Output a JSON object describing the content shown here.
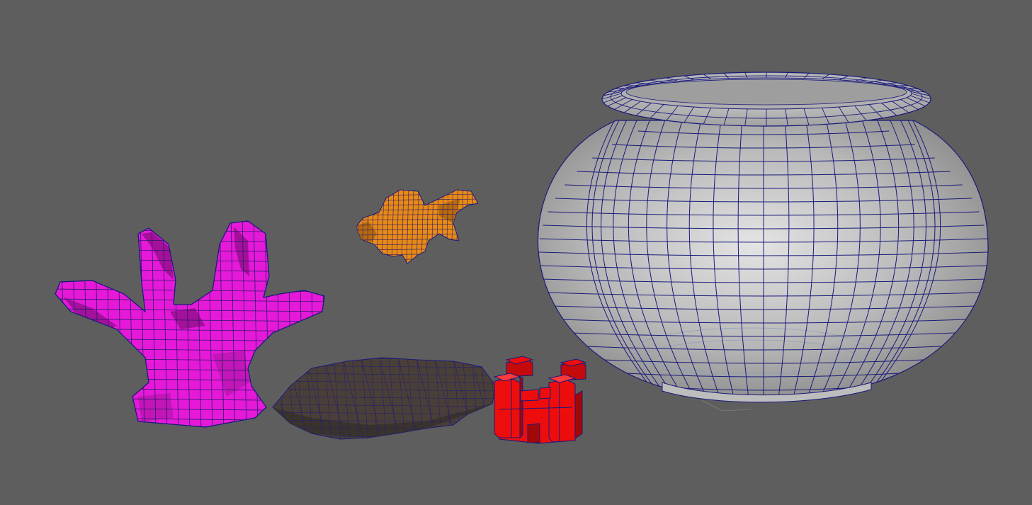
{
  "viewport": {
    "background": "#5e5e5e",
    "wire_color": "#1a1a7a"
  },
  "objects": [
    {
      "name": "coral",
      "color": "#e619d9",
      "shade": "#a3109a"
    },
    {
      "name": "goldfish",
      "color": "#e88a16",
      "shade": "#a85c0a"
    },
    {
      "name": "rock",
      "color": "#4a3f38",
      "shade": "#2e2723"
    },
    {
      "name": "castle",
      "color": "#ee0d0d",
      "shade": "#a30808"
    },
    {
      "name": "fishbowl",
      "color": "#c9c9c9",
      "shade": "#8e8e8e"
    }
  ]
}
